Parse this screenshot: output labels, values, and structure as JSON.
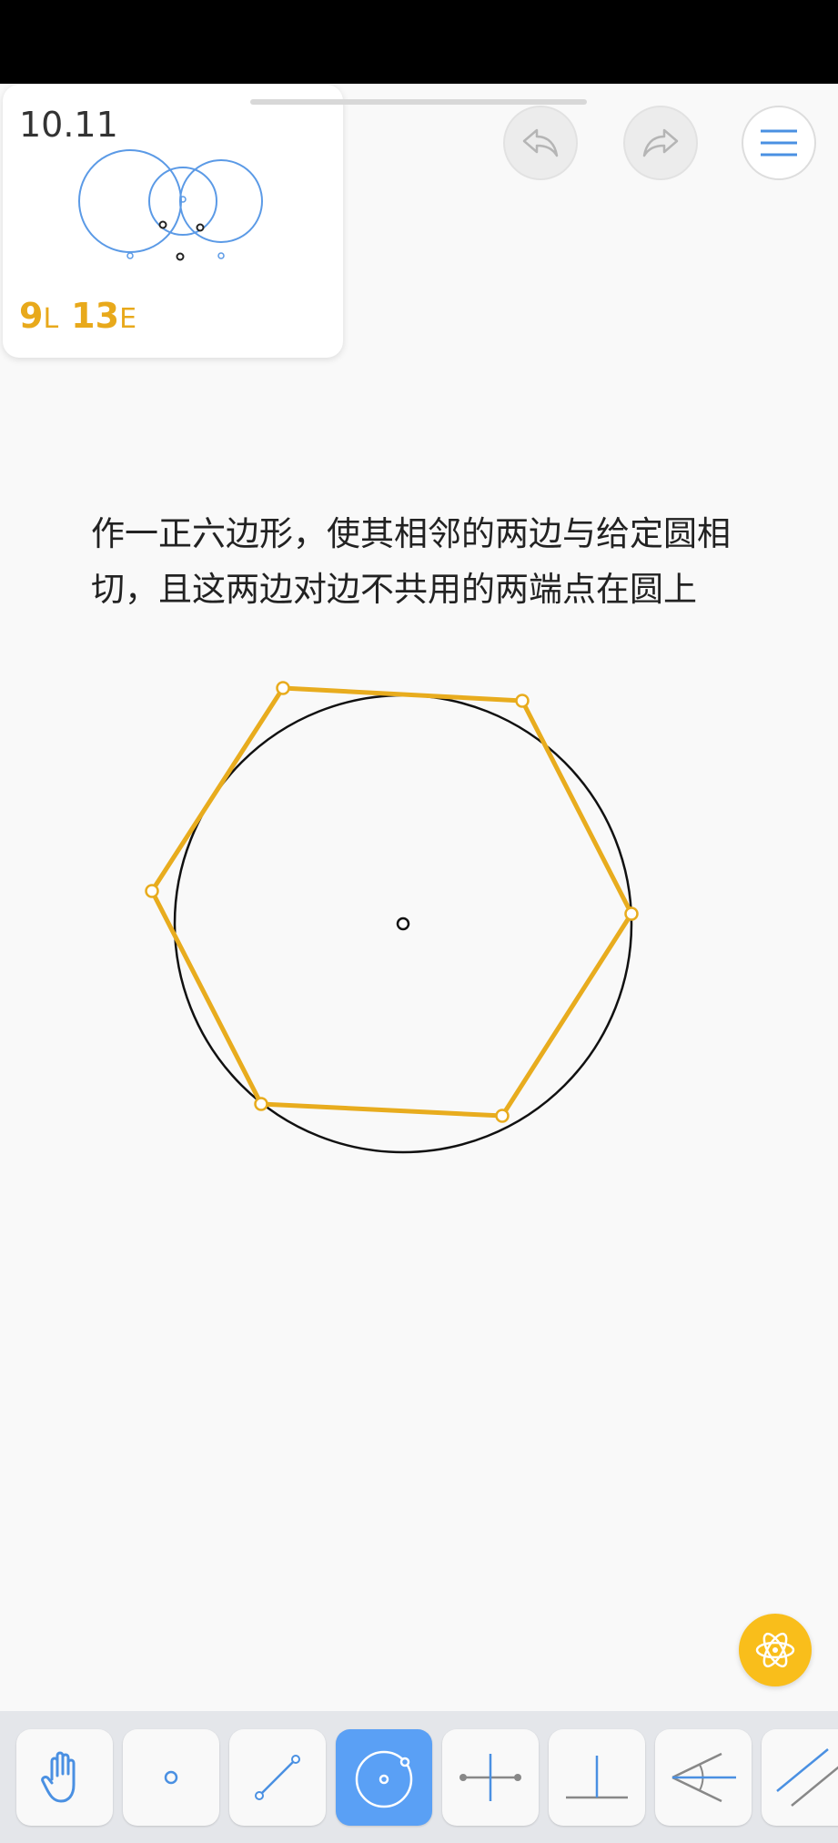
{
  "level": {
    "number": "10.11",
    "lines_count": "9",
    "lines_unit": "L",
    "elements_count": "13",
    "elements_unit": "E"
  },
  "task": {
    "line1": "作一正六边形，使其相邻的两边与给定圆相",
    "line2": "切，且这两边对边不共用的两端点在圆上"
  },
  "header_buttons": {
    "undo_icon": "undo-arrow-icon",
    "redo_icon": "redo-arrow-icon",
    "menu_icon": "hamburger-menu-icon"
  },
  "toolbar": {
    "tools": [
      "move-hand",
      "point",
      "line-segment",
      "circle",
      "perpendicular-bisector",
      "perpendicular",
      "angle-bisector",
      "parallel"
    ],
    "active_tool": "circle"
  },
  "colors": {
    "accent_yellow": "#e8a91b",
    "hexagon": "#e8ac1e",
    "thumb_blue": "#5b9ae6",
    "active_tool": "#5aa0f5",
    "fab": "#f9be1b"
  }
}
